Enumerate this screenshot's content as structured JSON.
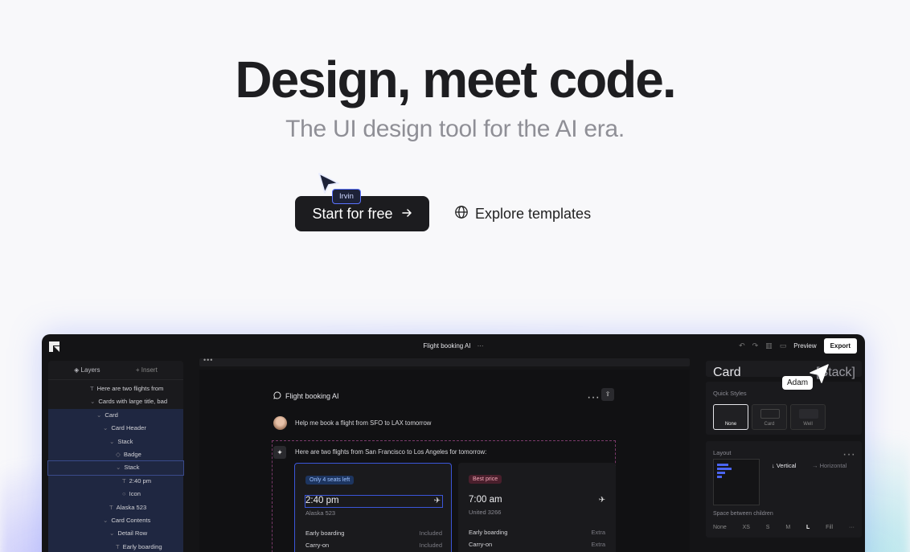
{
  "hero": {
    "title": "Design, meet code.",
    "subtitle": "The UI design tool for the AI era.",
    "primary_cta": "Start for free",
    "secondary_cta": "Explore templates"
  },
  "app": {
    "doc_title": "Flight booking AI",
    "preview_label": "Preview",
    "export_label": "Export",
    "layers_tab": "Layers",
    "insert_tab": "+ Insert",
    "layers": [
      {
        "label": "Here are two flights from",
        "glyph": "T"
      },
      {
        "label": "Cards with large title, bad",
        "glyph": "⌄"
      },
      {
        "label": "Card",
        "glyph": "⌄"
      },
      {
        "label": "Card Header",
        "glyph": "⌄"
      },
      {
        "label": "Stack",
        "glyph": "⌄"
      },
      {
        "label": "Badge",
        "glyph": "◇"
      },
      {
        "label": "Stack",
        "glyph": "⌄"
      },
      {
        "label": "2:40 pm",
        "glyph": "T"
      },
      {
        "label": "Icon",
        "glyph": "○"
      },
      {
        "label": "Alaska 523",
        "glyph": "T"
      },
      {
        "label": "Card Contents",
        "glyph": "⌄"
      },
      {
        "label": "Detail Row",
        "glyph": "⌄"
      },
      {
        "label": "Early boarding",
        "glyph": "T"
      }
    ],
    "chat": {
      "title": "Flight booking AI",
      "user_message": "Help me book a flight from SFO to LAX tomorrow",
      "ai_message": "Here are two flights from San Francisco to Los Angeles for tomorrow:"
    },
    "flights": [
      {
        "badge": "Only 4 seats left",
        "time": "2:40 pm",
        "flight": "Alaska 523",
        "rows": [
          {
            "label": "Early boarding",
            "value": "Included"
          },
          {
            "label": "Carry-on",
            "value": "Included"
          }
        ]
      },
      {
        "badge": "Best price",
        "time": "7:00 am",
        "flight": "United 3266",
        "rows": [
          {
            "label": "Early boarding",
            "value": "Extra"
          },
          {
            "label": "Carry-on",
            "value": "Extra"
          }
        ]
      }
    ],
    "cursors": {
      "irvin": "Irvin",
      "adam": "Adam"
    },
    "inspector": {
      "element": "Card",
      "element_type": "[Stack]",
      "quick_styles_title": "Quick Styles",
      "quick_styles": [
        "None",
        "Card",
        "Well"
      ],
      "layout_title": "Layout",
      "direction_vertical": "↓ Vertical",
      "direction_horizontal": "→ Horizontal",
      "space_label": "Space between children",
      "space_options": [
        "None",
        "XS",
        "S",
        "M",
        "L",
        "Fill",
        "···"
      ]
    },
    "colors": {
      "accent": "#3b56d9",
      "badge_blue": "#1d3560",
      "badge_red": "#4a1f2c"
    }
  }
}
